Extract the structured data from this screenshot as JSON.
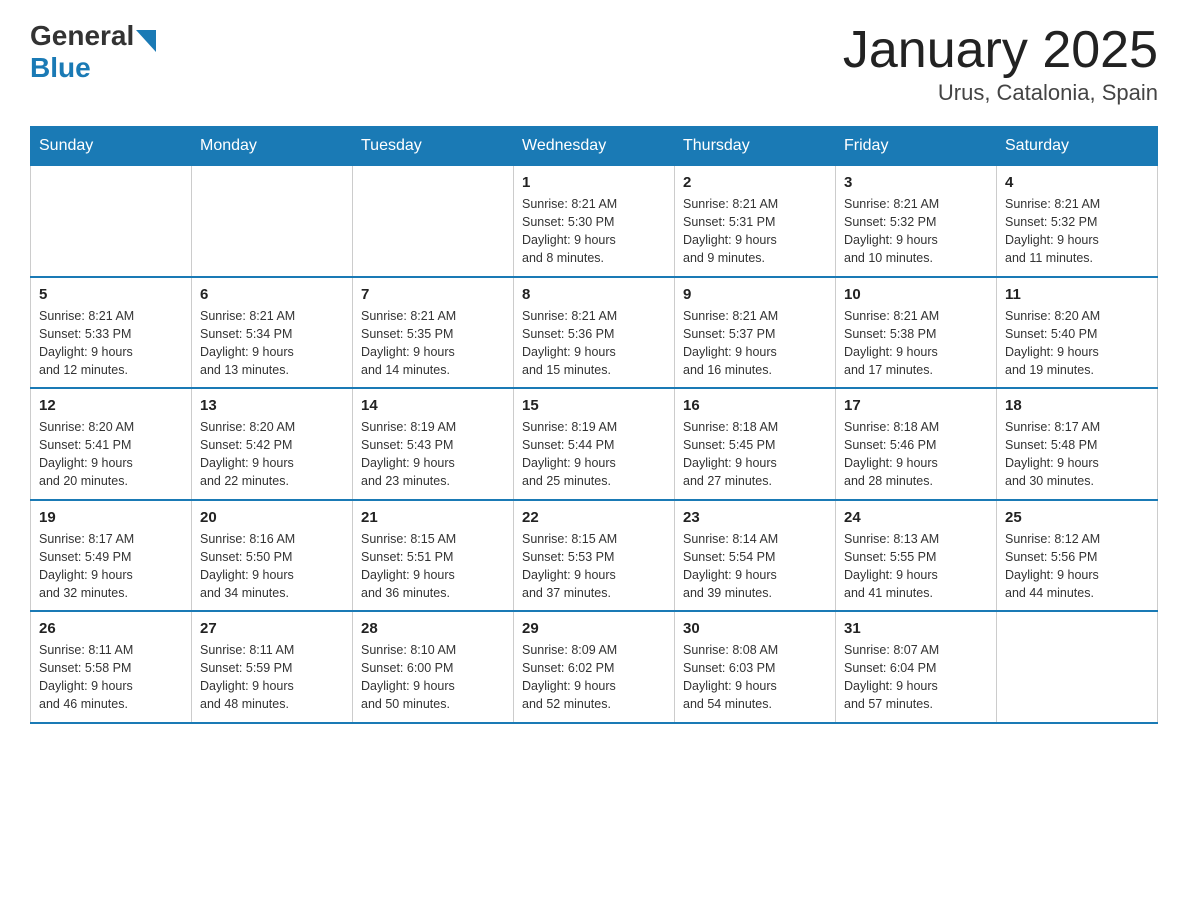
{
  "header": {
    "logo_general": "General",
    "logo_blue": "Blue",
    "month_title": "January 2025",
    "location": "Urus, Catalonia, Spain"
  },
  "days_of_week": [
    "Sunday",
    "Monday",
    "Tuesday",
    "Wednesday",
    "Thursday",
    "Friday",
    "Saturday"
  ],
  "weeks": [
    [
      {
        "day": "",
        "info": ""
      },
      {
        "day": "",
        "info": ""
      },
      {
        "day": "",
        "info": ""
      },
      {
        "day": "1",
        "info": "Sunrise: 8:21 AM\nSunset: 5:30 PM\nDaylight: 9 hours\nand 8 minutes."
      },
      {
        "day": "2",
        "info": "Sunrise: 8:21 AM\nSunset: 5:31 PM\nDaylight: 9 hours\nand 9 minutes."
      },
      {
        "day": "3",
        "info": "Sunrise: 8:21 AM\nSunset: 5:32 PM\nDaylight: 9 hours\nand 10 minutes."
      },
      {
        "day": "4",
        "info": "Sunrise: 8:21 AM\nSunset: 5:32 PM\nDaylight: 9 hours\nand 11 minutes."
      }
    ],
    [
      {
        "day": "5",
        "info": "Sunrise: 8:21 AM\nSunset: 5:33 PM\nDaylight: 9 hours\nand 12 minutes."
      },
      {
        "day": "6",
        "info": "Sunrise: 8:21 AM\nSunset: 5:34 PM\nDaylight: 9 hours\nand 13 minutes."
      },
      {
        "day": "7",
        "info": "Sunrise: 8:21 AM\nSunset: 5:35 PM\nDaylight: 9 hours\nand 14 minutes."
      },
      {
        "day": "8",
        "info": "Sunrise: 8:21 AM\nSunset: 5:36 PM\nDaylight: 9 hours\nand 15 minutes."
      },
      {
        "day": "9",
        "info": "Sunrise: 8:21 AM\nSunset: 5:37 PM\nDaylight: 9 hours\nand 16 minutes."
      },
      {
        "day": "10",
        "info": "Sunrise: 8:21 AM\nSunset: 5:38 PM\nDaylight: 9 hours\nand 17 minutes."
      },
      {
        "day": "11",
        "info": "Sunrise: 8:20 AM\nSunset: 5:40 PM\nDaylight: 9 hours\nand 19 minutes."
      }
    ],
    [
      {
        "day": "12",
        "info": "Sunrise: 8:20 AM\nSunset: 5:41 PM\nDaylight: 9 hours\nand 20 minutes."
      },
      {
        "day": "13",
        "info": "Sunrise: 8:20 AM\nSunset: 5:42 PM\nDaylight: 9 hours\nand 22 minutes."
      },
      {
        "day": "14",
        "info": "Sunrise: 8:19 AM\nSunset: 5:43 PM\nDaylight: 9 hours\nand 23 minutes."
      },
      {
        "day": "15",
        "info": "Sunrise: 8:19 AM\nSunset: 5:44 PM\nDaylight: 9 hours\nand 25 minutes."
      },
      {
        "day": "16",
        "info": "Sunrise: 8:18 AM\nSunset: 5:45 PM\nDaylight: 9 hours\nand 27 minutes."
      },
      {
        "day": "17",
        "info": "Sunrise: 8:18 AM\nSunset: 5:46 PM\nDaylight: 9 hours\nand 28 minutes."
      },
      {
        "day": "18",
        "info": "Sunrise: 8:17 AM\nSunset: 5:48 PM\nDaylight: 9 hours\nand 30 minutes."
      }
    ],
    [
      {
        "day": "19",
        "info": "Sunrise: 8:17 AM\nSunset: 5:49 PM\nDaylight: 9 hours\nand 32 minutes."
      },
      {
        "day": "20",
        "info": "Sunrise: 8:16 AM\nSunset: 5:50 PM\nDaylight: 9 hours\nand 34 minutes."
      },
      {
        "day": "21",
        "info": "Sunrise: 8:15 AM\nSunset: 5:51 PM\nDaylight: 9 hours\nand 36 minutes."
      },
      {
        "day": "22",
        "info": "Sunrise: 8:15 AM\nSunset: 5:53 PM\nDaylight: 9 hours\nand 37 minutes."
      },
      {
        "day": "23",
        "info": "Sunrise: 8:14 AM\nSunset: 5:54 PM\nDaylight: 9 hours\nand 39 minutes."
      },
      {
        "day": "24",
        "info": "Sunrise: 8:13 AM\nSunset: 5:55 PM\nDaylight: 9 hours\nand 41 minutes."
      },
      {
        "day": "25",
        "info": "Sunrise: 8:12 AM\nSunset: 5:56 PM\nDaylight: 9 hours\nand 44 minutes."
      }
    ],
    [
      {
        "day": "26",
        "info": "Sunrise: 8:11 AM\nSunset: 5:58 PM\nDaylight: 9 hours\nand 46 minutes."
      },
      {
        "day": "27",
        "info": "Sunrise: 8:11 AM\nSunset: 5:59 PM\nDaylight: 9 hours\nand 48 minutes."
      },
      {
        "day": "28",
        "info": "Sunrise: 8:10 AM\nSunset: 6:00 PM\nDaylight: 9 hours\nand 50 minutes."
      },
      {
        "day": "29",
        "info": "Sunrise: 8:09 AM\nSunset: 6:02 PM\nDaylight: 9 hours\nand 52 minutes."
      },
      {
        "day": "30",
        "info": "Sunrise: 8:08 AM\nSunset: 6:03 PM\nDaylight: 9 hours\nand 54 minutes."
      },
      {
        "day": "31",
        "info": "Sunrise: 8:07 AM\nSunset: 6:04 PM\nDaylight: 9 hours\nand 57 minutes."
      },
      {
        "day": "",
        "info": ""
      }
    ]
  ]
}
